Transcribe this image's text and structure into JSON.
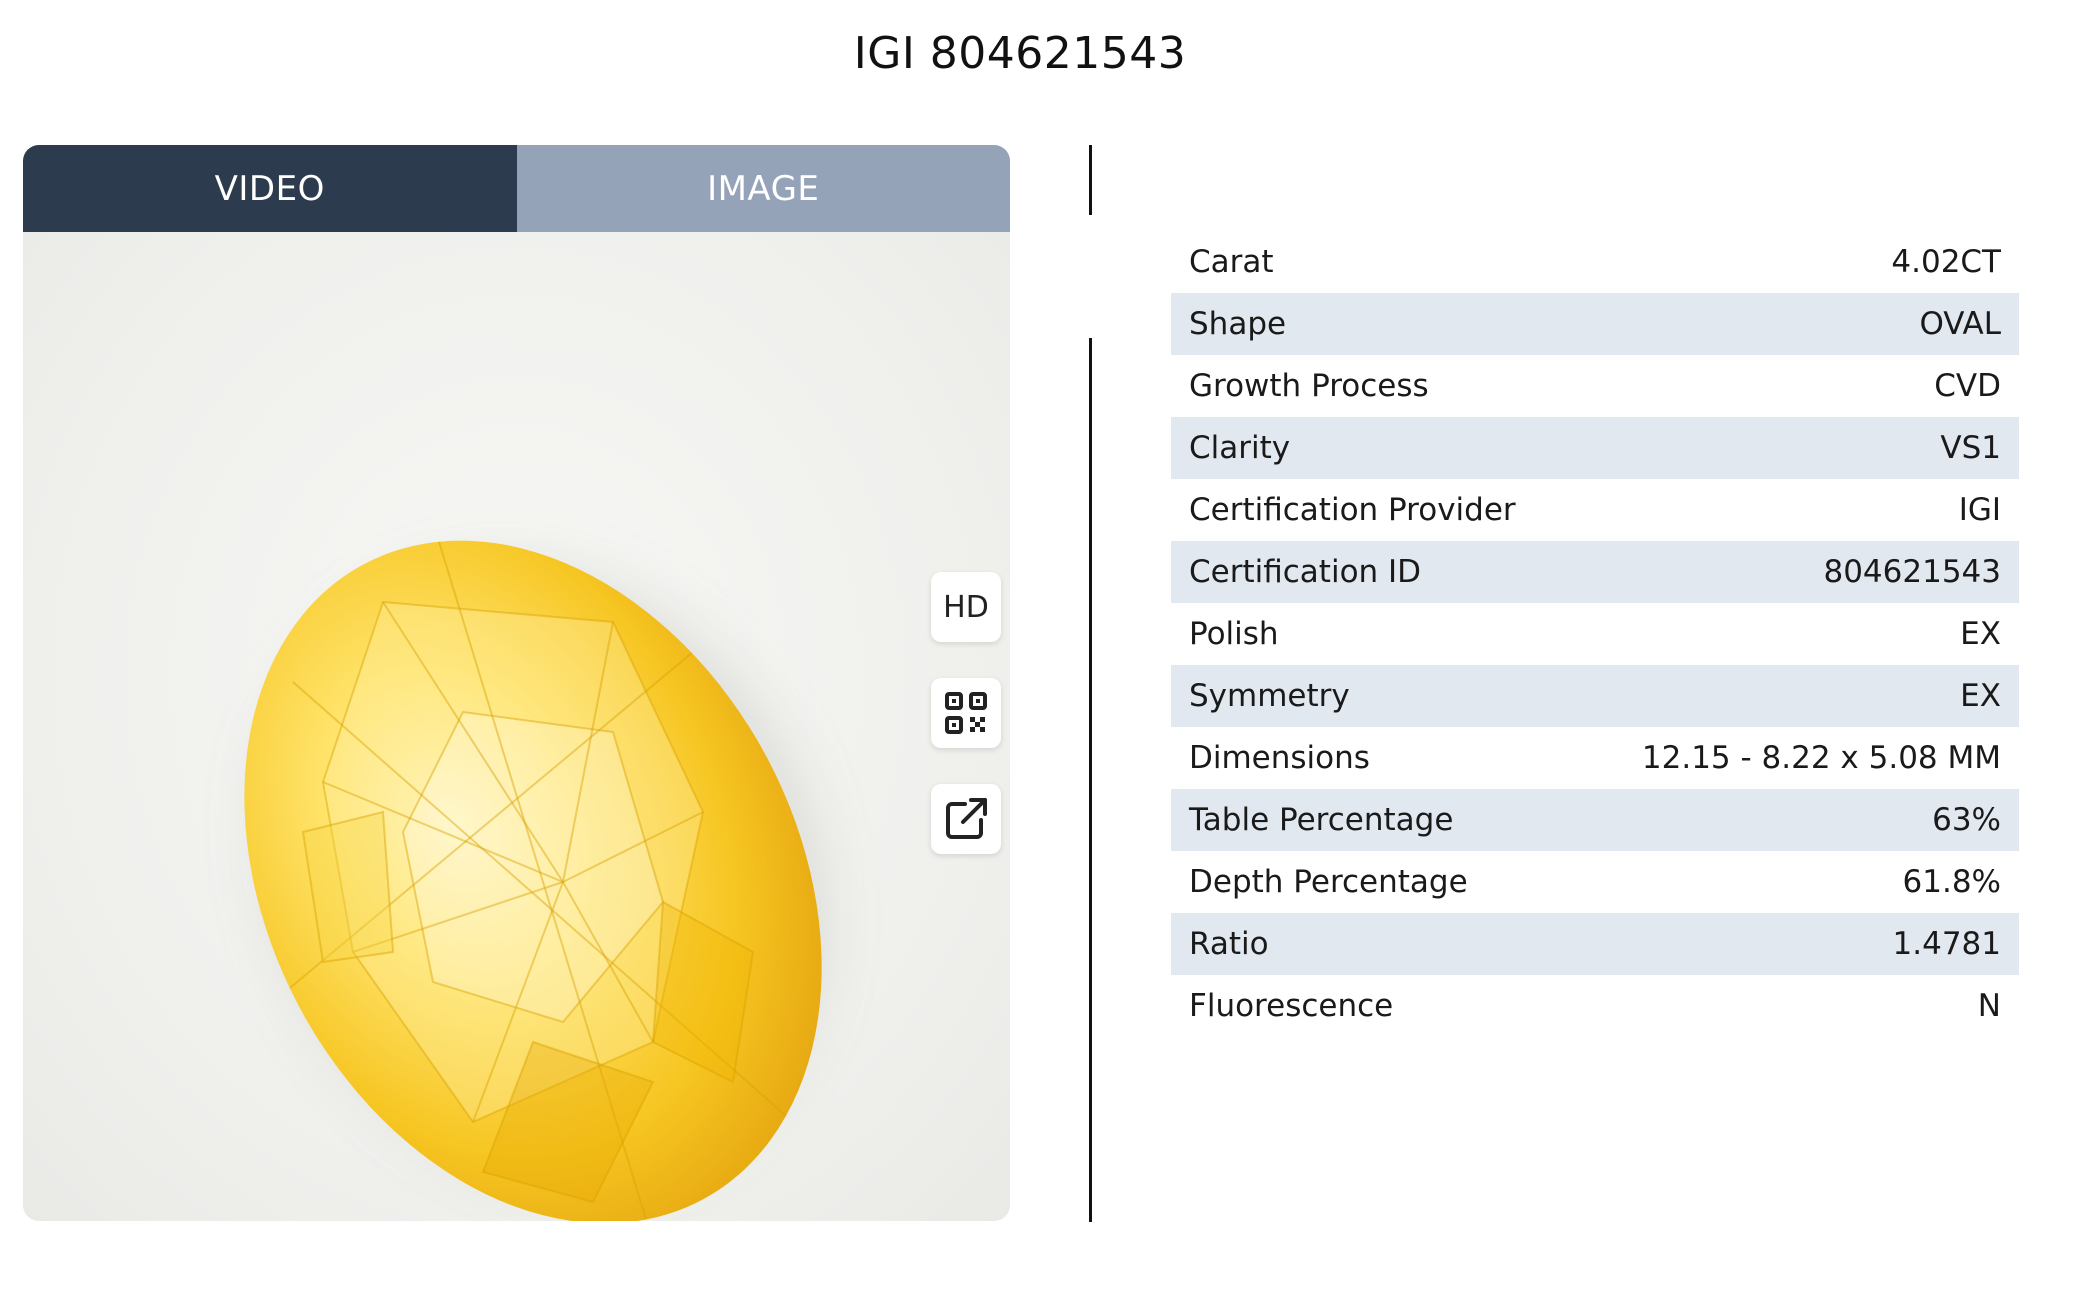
{
  "page": {
    "title": "IGI 804621543"
  },
  "media": {
    "tabs": [
      {
        "label": "VIDEO",
        "active": true
      },
      {
        "label": "IMAGE",
        "active": false
      }
    ],
    "buttons": {
      "hd_label": "HD",
      "qr_icon": "qr-code-icon",
      "external_icon": "external-link-icon"
    },
    "gem_color": "#f6c521"
  },
  "specs": [
    {
      "label": "Carat",
      "value": "4.02CT"
    },
    {
      "label": "Shape",
      "value": "OVAL"
    },
    {
      "label": "Growth Process",
      "value": "CVD"
    },
    {
      "label": "Clarity",
      "value": "VS1"
    },
    {
      "label": "Certification Provider",
      "value": "IGI"
    },
    {
      "label": "Certification ID",
      "value": "804621543"
    },
    {
      "label": "Polish",
      "value": "EX"
    },
    {
      "label": "Symmetry",
      "value": "EX"
    },
    {
      "label": "Dimensions",
      "value": "12.15 - 8.22 x 5.08 MM"
    },
    {
      "label": "Table Percentage",
      "value": "63%"
    },
    {
      "label": "Depth Percentage",
      "value": "61.8%"
    },
    {
      "label": "Ratio",
      "value": "1.4781"
    },
    {
      "label": "Fluorescence",
      "value": "N"
    }
  ]
}
